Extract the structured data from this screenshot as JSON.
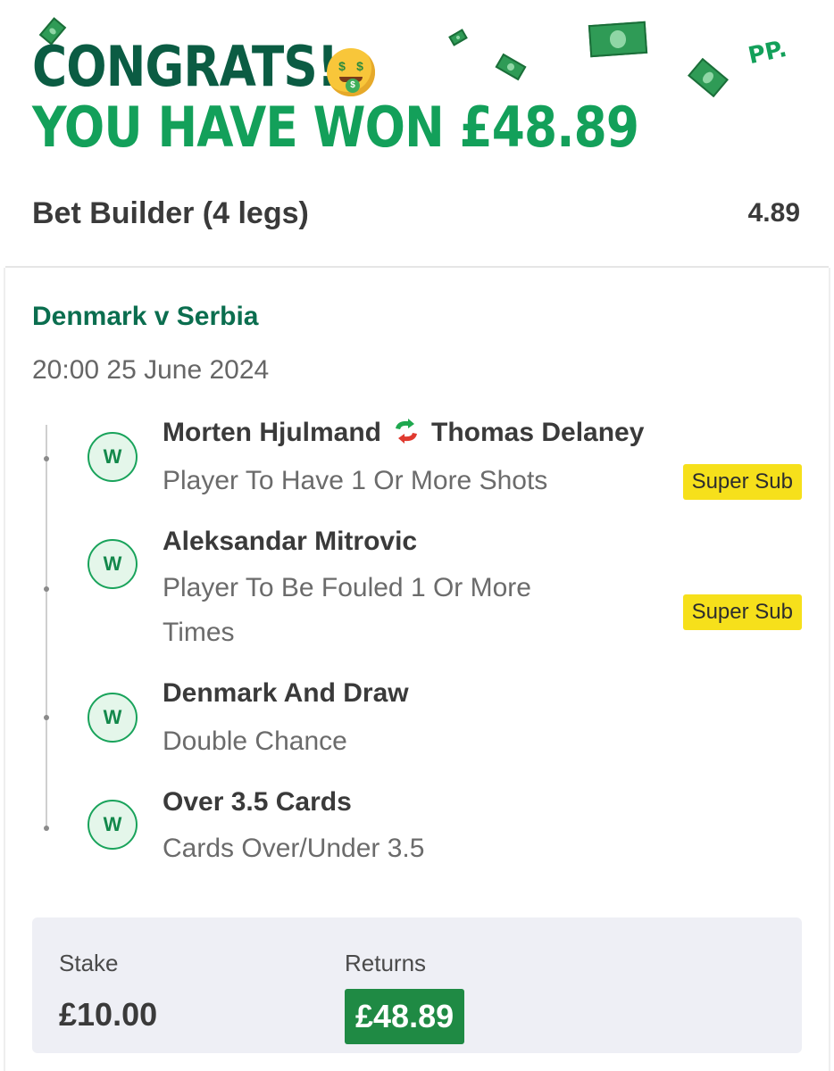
{
  "header": {
    "congrats": "CONGRATS!",
    "won_text": "YOU HAVE WON £48.89",
    "logo_text": "PP.",
    "emoji": "money-mouth-face"
  },
  "bet": {
    "title": "Bet Builder (4 legs)",
    "odds": "4.89"
  },
  "event": {
    "match": "Denmark v Serbia",
    "datetime": "20:00 25 June 2024"
  },
  "legs": [
    {
      "status": "W",
      "player_out": "Morten Hjulmand",
      "player_in": "Thomas Delaney",
      "market": "Player To Have 1 Or More Shots",
      "badge": "Super Sub"
    },
    {
      "status": "W",
      "title": "Aleksandar Mitrovic",
      "market_line1": "Player To Be Fouled 1 Or More",
      "market_line2": "Times",
      "badge": "Super Sub"
    },
    {
      "status": "W",
      "title": "Denmark And Draw",
      "market": "Double Chance"
    },
    {
      "status": "W",
      "title": "Over 3.5 Cards",
      "market": "Cards Over/Under 3.5"
    }
  ],
  "footer": {
    "stake_label": "Stake",
    "stake_value": "£10.00",
    "returns_label": "Returns",
    "returns_value": "£48.89"
  },
  "colors": {
    "brand_dark": "#0b5c43",
    "brand_green": "#13a05a",
    "badge_yellow": "#f6e01b",
    "returns_green": "#1f8a44"
  }
}
